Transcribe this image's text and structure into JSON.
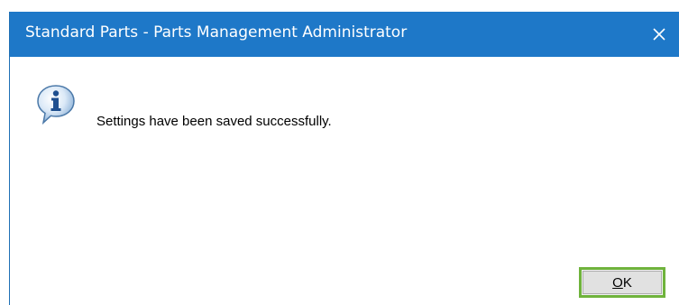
{
  "window": {
    "title": "Standard Parts - Parts Management Administrator",
    "close_icon": "close-icon"
  },
  "message": {
    "icon": "info-icon",
    "text": "Settings have been saved successfully."
  },
  "buttons": {
    "ok_accel": "O",
    "ok_rest": "K"
  },
  "colors": {
    "titlebar": "#1e78c8",
    "focus_highlight": "#6fb33c"
  }
}
